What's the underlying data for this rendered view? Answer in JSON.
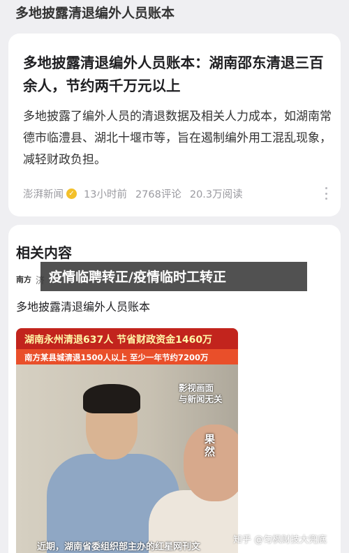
{
  "header": {
    "title": "多地披露清退编外人员账本"
  },
  "article": {
    "title": "多地披露清退编外人员账本：湖南邵东清退三百余人，节约两千万元以上",
    "summary": "多地披露了编外人员的清退数据及相关人力成本，如湖南常德市临澧县、湖北十堰市等，旨在遏制编外用工混乱现象，减轻财政负担。",
    "source": "澎湃新闻",
    "verified_icon": "verified-badge-icon",
    "time": "13小时前",
    "comments": "2768评论",
    "reads": "20.3万阅读",
    "more_icon": "more-vertical-icon"
  },
  "related": {
    "heading": "相关内容",
    "sub_source_logo": "南方",
    "sub_source": "济",
    "item_title": "多地披露清退编外人员账本",
    "thumb": {
      "banner1": "湖南永州清退637人 节省财政资金1460万",
      "banner2": "南方某县城清退1500人以上 至少一年节约7200万",
      "caption_right": "影视画面\n与新闻无关",
      "seal": "果然",
      "subtitle": "近期，湖南省委组织部主办的红星网刊文"
    }
  },
  "overlay": {
    "text": "疫情临聘转正/疫情临时工转正"
  },
  "watermark": {
    "text": "知乎 @匀枫财技大兜底"
  },
  "colors": {
    "background": "#efeff2",
    "card": "#ffffff",
    "verified": "#f3c02a",
    "banner_red": "#c2241d"
  }
}
